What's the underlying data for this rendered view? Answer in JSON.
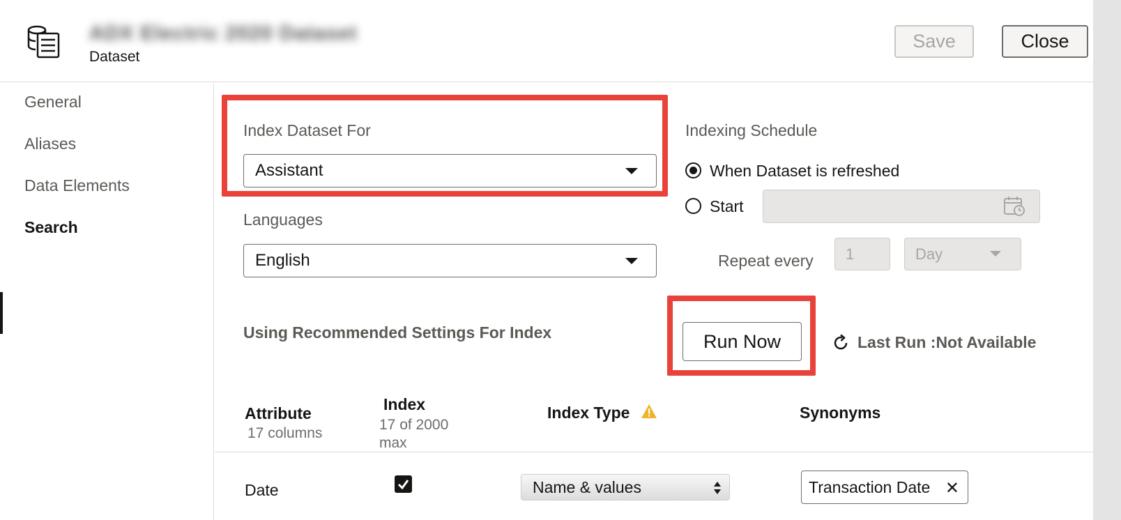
{
  "header": {
    "dataset_name": "ADX Electric 2020 Dataset",
    "dataset_type": "Dataset",
    "save_label": "Save",
    "close_label": "Close"
  },
  "sidebar": {
    "items": [
      {
        "label": "General",
        "active": false
      },
      {
        "label": "Aliases",
        "active": false
      },
      {
        "label": "Data Elements",
        "active": false
      },
      {
        "label": "Search",
        "active": true
      }
    ]
  },
  "index_for": {
    "label": "Index Dataset For",
    "value": "Assistant"
  },
  "languages": {
    "label": "Languages",
    "value": "English"
  },
  "schedule": {
    "label": "Indexing Schedule",
    "option_refresh": "When Dataset is refreshed",
    "option_start": "Start",
    "repeat_label": "Repeat every",
    "repeat_value": "1",
    "repeat_unit": "Day"
  },
  "recommended_text": "Using Recommended Settings For Index",
  "run_now_label": "Run Now",
  "last_run_text": "Last Run :Not Available",
  "table": {
    "col_attribute": "Attribute",
    "col_attribute_sub": "17 columns",
    "col_index": "Index",
    "col_index_sub": "17 of 2000 max",
    "col_index_type": "Index Type",
    "col_synonyms": "Synonyms",
    "rows": [
      {
        "attribute": "Date",
        "indexed": true,
        "index_type": "Name & values",
        "synonym": "Transaction Date"
      }
    ]
  },
  "colors": {
    "highlight": "#e8423a",
    "warning": "#f0b429"
  }
}
